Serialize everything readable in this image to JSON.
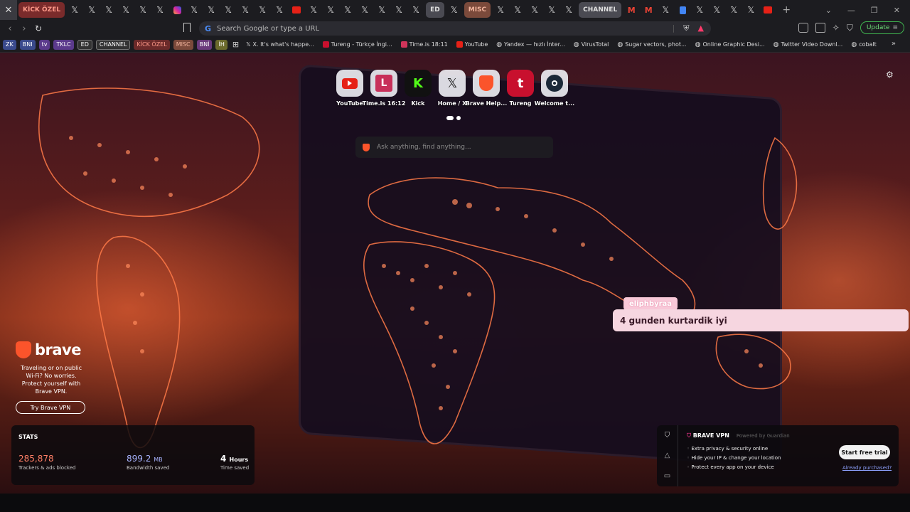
{
  "tabs": {
    "close_glyph": "✕",
    "x_glyph": "𝕏",
    "group_kick": "KİCK ÖZEL",
    "group_ed": "ED",
    "group_misc": "MISC",
    "group_channel": "CHANNEL",
    "new_tab": "+"
  },
  "toolbar": {
    "url_placeholder": "Search Google or type a URL",
    "update_label": "Update"
  },
  "bookmarks": {
    "groups": [
      "ZK",
      "BNI",
      "tv",
      "TKLC",
      "ED",
      "CHANNEL",
      "KİCK ÖZEL",
      "MISC",
      "BNİ",
      "İH"
    ],
    "items": [
      "X. It's what's happe...",
      "Tureng - Türkçe İngi...",
      "Time.is 18:11",
      "YouTube",
      "Yandex — hızlı İnter...",
      "VirusTotal",
      "Sugar vectors, phot...",
      "Online Graphic Desi...",
      "Twitter Video Downl...",
      "cobalt"
    ],
    "more": "»"
  },
  "shortcuts": [
    {
      "label": "YouTube",
      "icon": "youtube-icon"
    },
    {
      "label": "Time.is 16:12",
      "icon": "timeis-icon"
    },
    {
      "label": "Kick",
      "icon": "kick-icon"
    },
    {
      "label": "Home / X",
      "icon": "x-icon"
    },
    {
      "label": "Brave Help...",
      "icon": "brave-icon"
    },
    {
      "label": "Tureng",
      "icon": "tureng-icon"
    },
    {
      "label": "Welcome t...",
      "icon": "steam-icon"
    }
  ],
  "search": {
    "placeholder": "Ask anything, find anything..."
  },
  "promo": {
    "brand": "brave",
    "text": "Traveling or on public Wi-Fi? No worries. Protect yourself with Brave VPN.",
    "button": "Try Brave VPN"
  },
  "chat": {
    "username": "eliphbyraa",
    "message": "4 gunden kurtardik iyi"
  },
  "stats": {
    "title": "STATS",
    "trackers_value": "285,878",
    "trackers_label": "Trackers & ads blocked",
    "bandwidth_value": "899.2",
    "bandwidth_unit": "MB",
    "bandwidth_label": "Bandwidth saved",
    "time_value": "4",
    "time_unit": "Hours",
    "time_label": "Time saved"
  },
  "vpn": {
    "title": "BRAVE VPN",
    "powered": "Powered by Guardian",
    "features": [
      "Extra privacy & security online",
      "Hide your IP & change your location",
      "Protect every app on your device"
    ],
    "cta": "Start free trial",
    "link": "Already purchased?"
  },
  "colors": {
    "accent": "#ff5a30",
    "tracker": "#ff7f66",
    "bandwidth": "#a8b4ff",
    "update": "#3fb24f"
  }
}
